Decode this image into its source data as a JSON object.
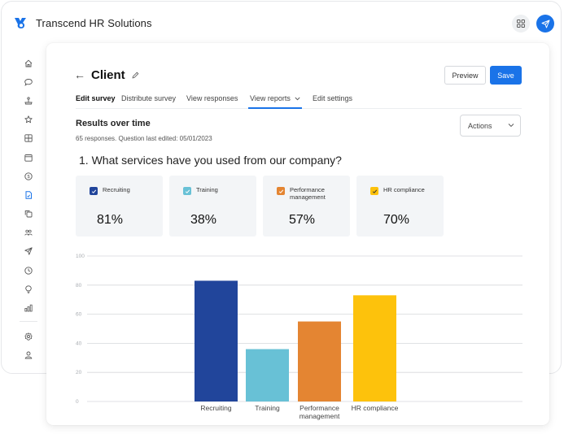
{
  "app": {
    "title": "Transcend HR Solutions",
    "brand_color": "#1a73e8",
    "header_icons": [
      "grid-icon",
      "send-icon"
    ]
  },
  "sidebar": {
    "items": [
      {
        "icon": "home-icon"
      },
      {
        "icon": "chat-bubble-icon"
      },
      {
        "icon": "joystick-icon"
      },
      {
        "icon": "star-icon"
      },
      {
        "icon": "dashboard-grid-icon"
      },
      {
        "icon": "calendar-icon"
      },
      {
        "icon": "dollar-icon"
      },
      {
        "icon": "survey-document-icon",
        "active": true
      },
      {
        "icon": "copy-icon"
      },
      {
        "icon": "users-icon"
      },
      {
        "icon": "send-icon"
      },
      {
        "icon": "clock-icon"
      },
      {
        "icon": "lightbulb-icon"
      },
      {
        "icon": "bar-chart-icon"
      }
    ],
    "bottom_items": [
      {
        "icon": "settings-icon"
      },
      {
        "icon": "user-icon"
      }
    ]
  },
  "page": {
    "title": "Client",
    "preview_label": "Preview",
    "save_label": "Save",
    "tabs": [
      {
        "label": "Edit survey",
        "bold": true
      },
      {
        "label": "Distribute survey"
      },
      {
        "label": "View responses"
      },
      {
        "label": "View reports",
        "active": true,
        "has_dropdown": true
      },
      {
        "label": "Edit settings"
      }
    ]
  },
  "results": {
    "section_title": "Results over time",
    "meta": "65 responses. Question last edited: 05/01/2023",
    "actions_label": "Actions",
    "question": "1. What services have you used from our company?",
    "stats": [
      {
        "label": "Recruiting",
        "value": "81%",
        "color": "#21459b",
        "checked": true
      },
      {
        "label": "Training",
        "value": "38%",
        "color": "#68c1d6",
        "checked": true
      },
      {
        "label": "Performance management",
        "value": "57%",
        "color": "#e48532",
        "checked": true
      },
      {
        "label": "HR compliance",
        "value": "70%",
        "color": "#fdc20c",
        "checked": true
      }
    ]
  },
  "chart_data": {
    "type": "bar",
    "title": "",
    "xlabel": "",
    "ylabel": "",
    "categories": [
      "Recruiting",
      "Training",
      "Performance management",
      "HR compliance"
    ],
    "category_label_lines": [
      [
        "Recruiting"
      ],
      [
        "Training"
      ],
      [
        "Performance",
        "management"
      ],
      [
        "HR compliance"
      ]
    ],
    "values": [
      83,
      36,
      55,
      73
    ],
    "colors": [
      "#21459b",
      "#68c1d6",
      "#e48532",
      "#fdc20c"
    ],
    "ylim": [
      0,
      100
    ],
    "yticks": [
      0,
      20,
      40,
      60,
      80,
      100
    ],
    "grid": true,
    "legend": "none"
  }
}
